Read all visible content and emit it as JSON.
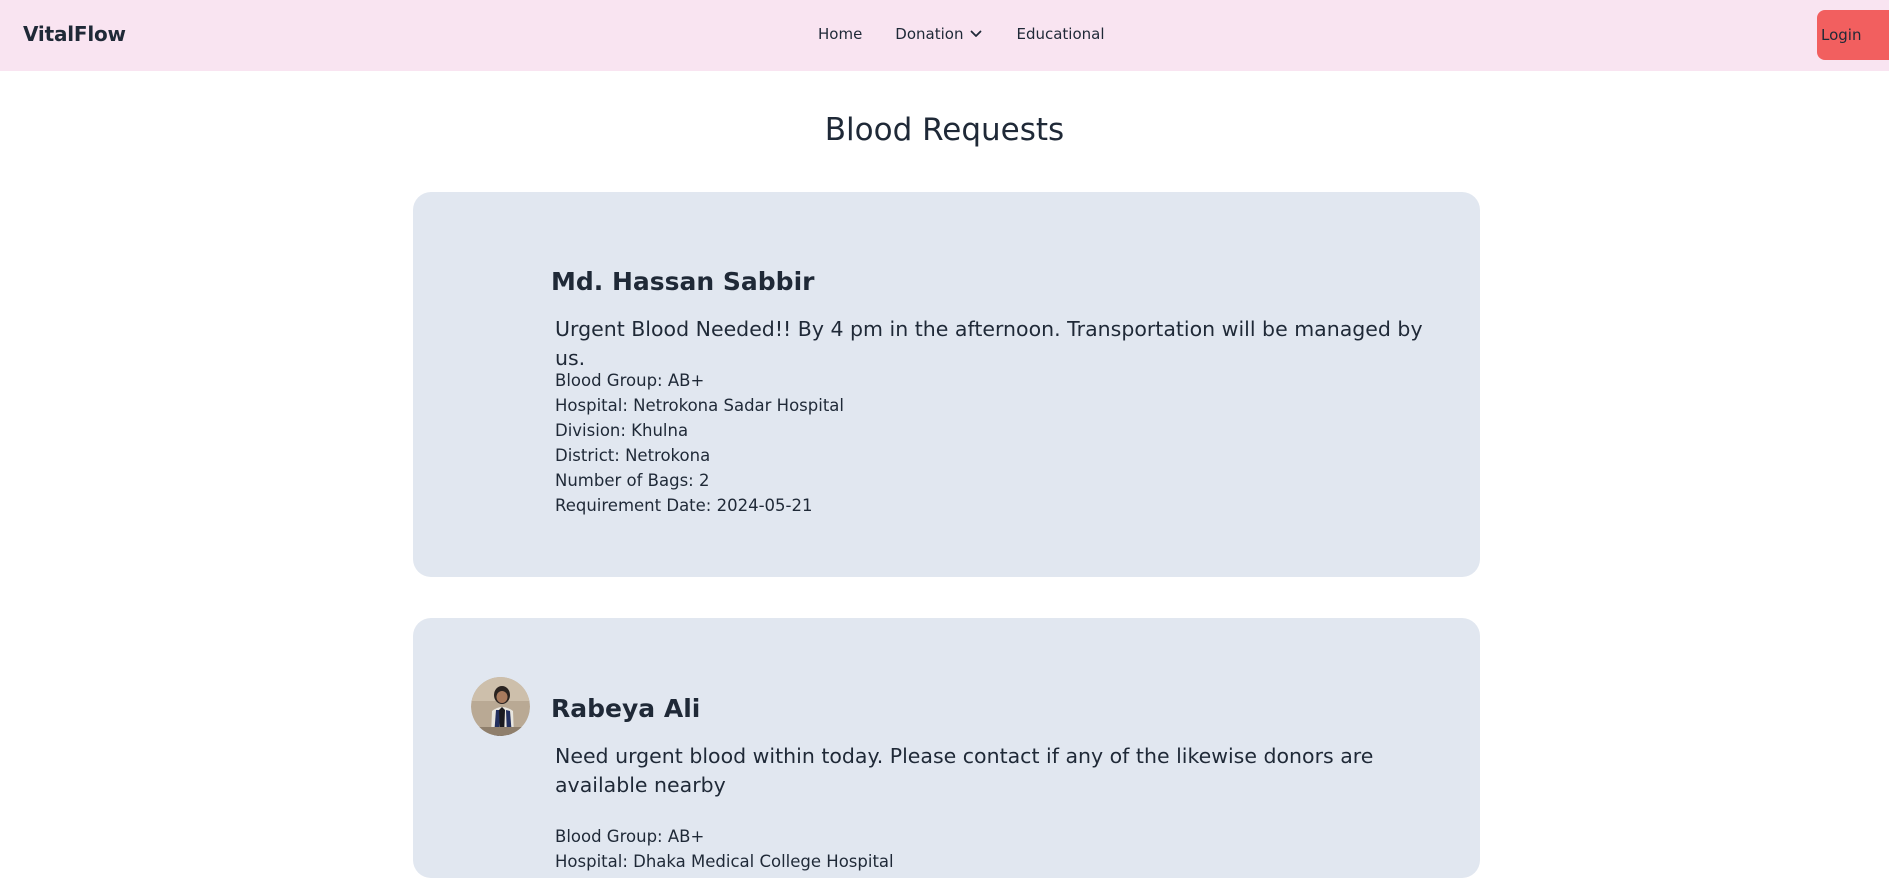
{
  "navbar": {
    "brand": "VitalFlow",
    "links": [
      {
        "label": "Home"
      },
      {
        "label": "Donation",
        "icon": "chevron-down-icon"
      },
      {
        "label": "Educational"
      }
    ],
    "login_label": "Login"
  },
  "page": {
    "title": "Blood Requests"
  },
  "requests": [
    {
      "name": "Md. Hassan Sabbir",
      "message": "Urgent Blood Needed!! By 4 pm in the afternoon. Transportation will be managed by us.",
      "details": [
        "Blood Group: AB+",
        "Hospital: Netrokona Sadar Hospital",
        "Division: Khulna",
        "District: Netrokona",
        "Number of Bags: 2",
        "Requirement Date: 2024-05-21"
      ]
    },
    {
      "name": "Rabeya Ali",
      "avatar": "profile-photo",
      "message": "Need urgent blood within today. Please contact if any of the likewise donors are available nearby",
      "details": [
        "Blood Group: AB+",
        "Hospital: Dhaka Medical College Hospital"
      ]
    }
  ],
  "colors": {
    "navbar_bg": "#f9e4f1",
    "login_bg": "#f25f5f",
    "card_bg": "#e1e7f0"
  }
}
